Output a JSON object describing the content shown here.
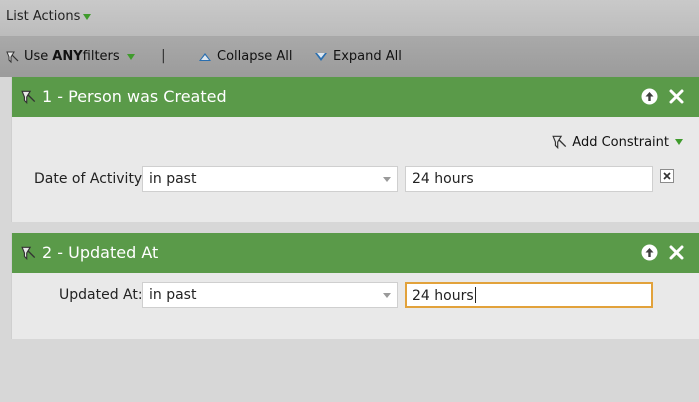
{
  "topbar": {
    "list_actions": "List Actions"
  },
  "toolbar": {
    "use_prefix": "Use ",
    "use_any": "ANY",
    "use_suffix": " filters",
    "separator": "|",
    "collapse_all": "Collapse All",
    "expand_all": "Expand All"
  },
  "filters": [
    {
      "title": "1 - Person was Created",
      "add_constraint": "Add Constraint",
      "row": {
        "label": "Date of Activity:",
        "operator": "in past",
        "value": "24 hours"
      }
    },
    {
      "title": "2 - Updated At",
      "row": {
        "label": "Updated At:",
        "operator": "in past",
        "value": "24 hours"
      }
    }
  ],
  "colors": {
    "header_green": "#5a9a49",
    "focus_orange": "#e2a23b",
    "accent_blue": "#2a6fb0"
  },
  "icons": [
    "funnel-icon",
    "caret-down-icon",
    "collapse-icon",
    "expand-icon",
    "move-up-icon",
    "close-icon",
    "remove-constraint-icon"
  ]
}
